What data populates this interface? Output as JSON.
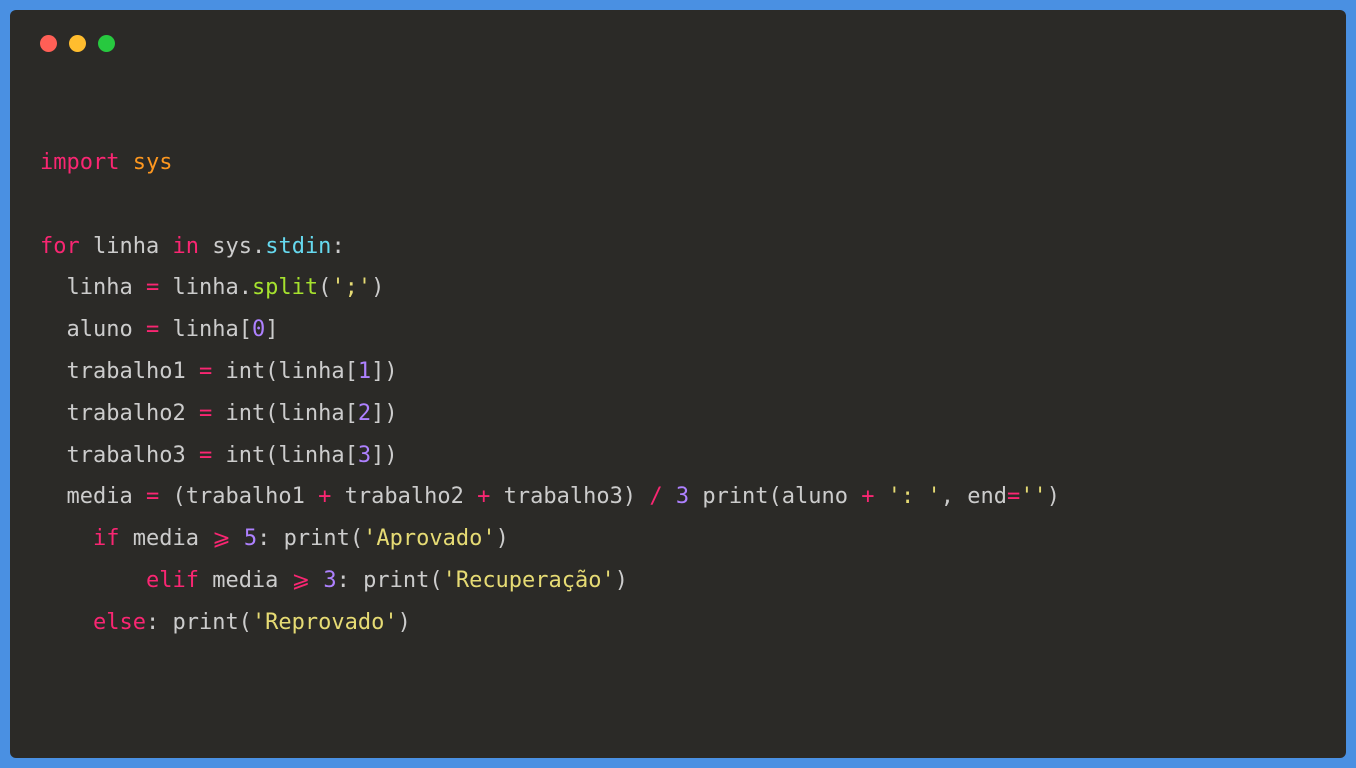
{
  "code": {
    "line1_import": "import",
    "line1_sys": "sys",
    "line3_for": "for",
    "line3_linha": " linha ",
    "line3_in": "in",
    "line3_sys": " sys",
    "line3_dot": ".",
    "line3_stdin": "stdin",
    "line3_colon": ":",
    "line4_a": "  linha ",
    "line4_eq": "=",
    "line4_b": " linha.",
    "line4_split": "split",
    "line4_c": "(",
    "line4_str": "';'",
    "line4_d": ")",
    "line5_a": "  aluno ",
    "line5_eq": "=",
    "line5_b": " linha[",
    "line5_num": "0",
    "line5_c": "]",
    "line6_a": "  trabalho1 ",
    "line6_eq": "=",
    "line6_b": " int(linha[",
    "line6_num": "1",
    "line6_c": "])",
    "line7_a": "  trabalho2 ",
    "line7_eq": "=",
    "line7_b": " int(linha[",
    "line7_num": "2",
    "line7_c": "])",
    "line8_a": "  trabalho3 ",
    "line8_eq": "=",
    "line8_b": " int(linha[",
    "line8_num": "3",
    "line8_c": "])",
    "line9_a": "  media ",
    "line9_eq": "=",
    "line9_b": " (trabalho1 ",
    "line9_plus1": "+",
    "line9_c": " trabalho2 ",
    "line9_plus2": "+",
    "line9_d": " trabalho3) ",
    "line9_div": "/",
    "line9_e": " ",
    "line9_num": "3",
    "line9_f": " print(aluno ",
    "line9_plus3": "+",
    "line9_g": " ",
    "line9_str1": "': '",
    "line9_h": ", end",
    "line9_eq2": "=",
    "line9_str2": "''",
    "line9_i": ")",
    "line10_a": "    ",
    "line10_if": "if",
    "line10_b": " media ",
    "line10_op": "⩾",
    "line10_c": " ",
    "line10_num": "5",
    "line10_d": ": print(",
    "line10_str": "'Aprovado'",
    "line10_e": ")",
    "line11_a": "        ",
    "line11_elif": "elif",
    "line11_b": " media ",
    "line11_op": "⩾",
    "line11_c": " ",
    "line11_num": "3",
    "line11_d": ": print(",
    "line11_str": "'Recuperação'",
    "line11_e": ")",
    "line12_a": "    ",
    "line12_else": "else",
    "line12_b": ": print(",
    "line12_str": "'Reprovado'",
    "line12_c": ")"
  }
}
